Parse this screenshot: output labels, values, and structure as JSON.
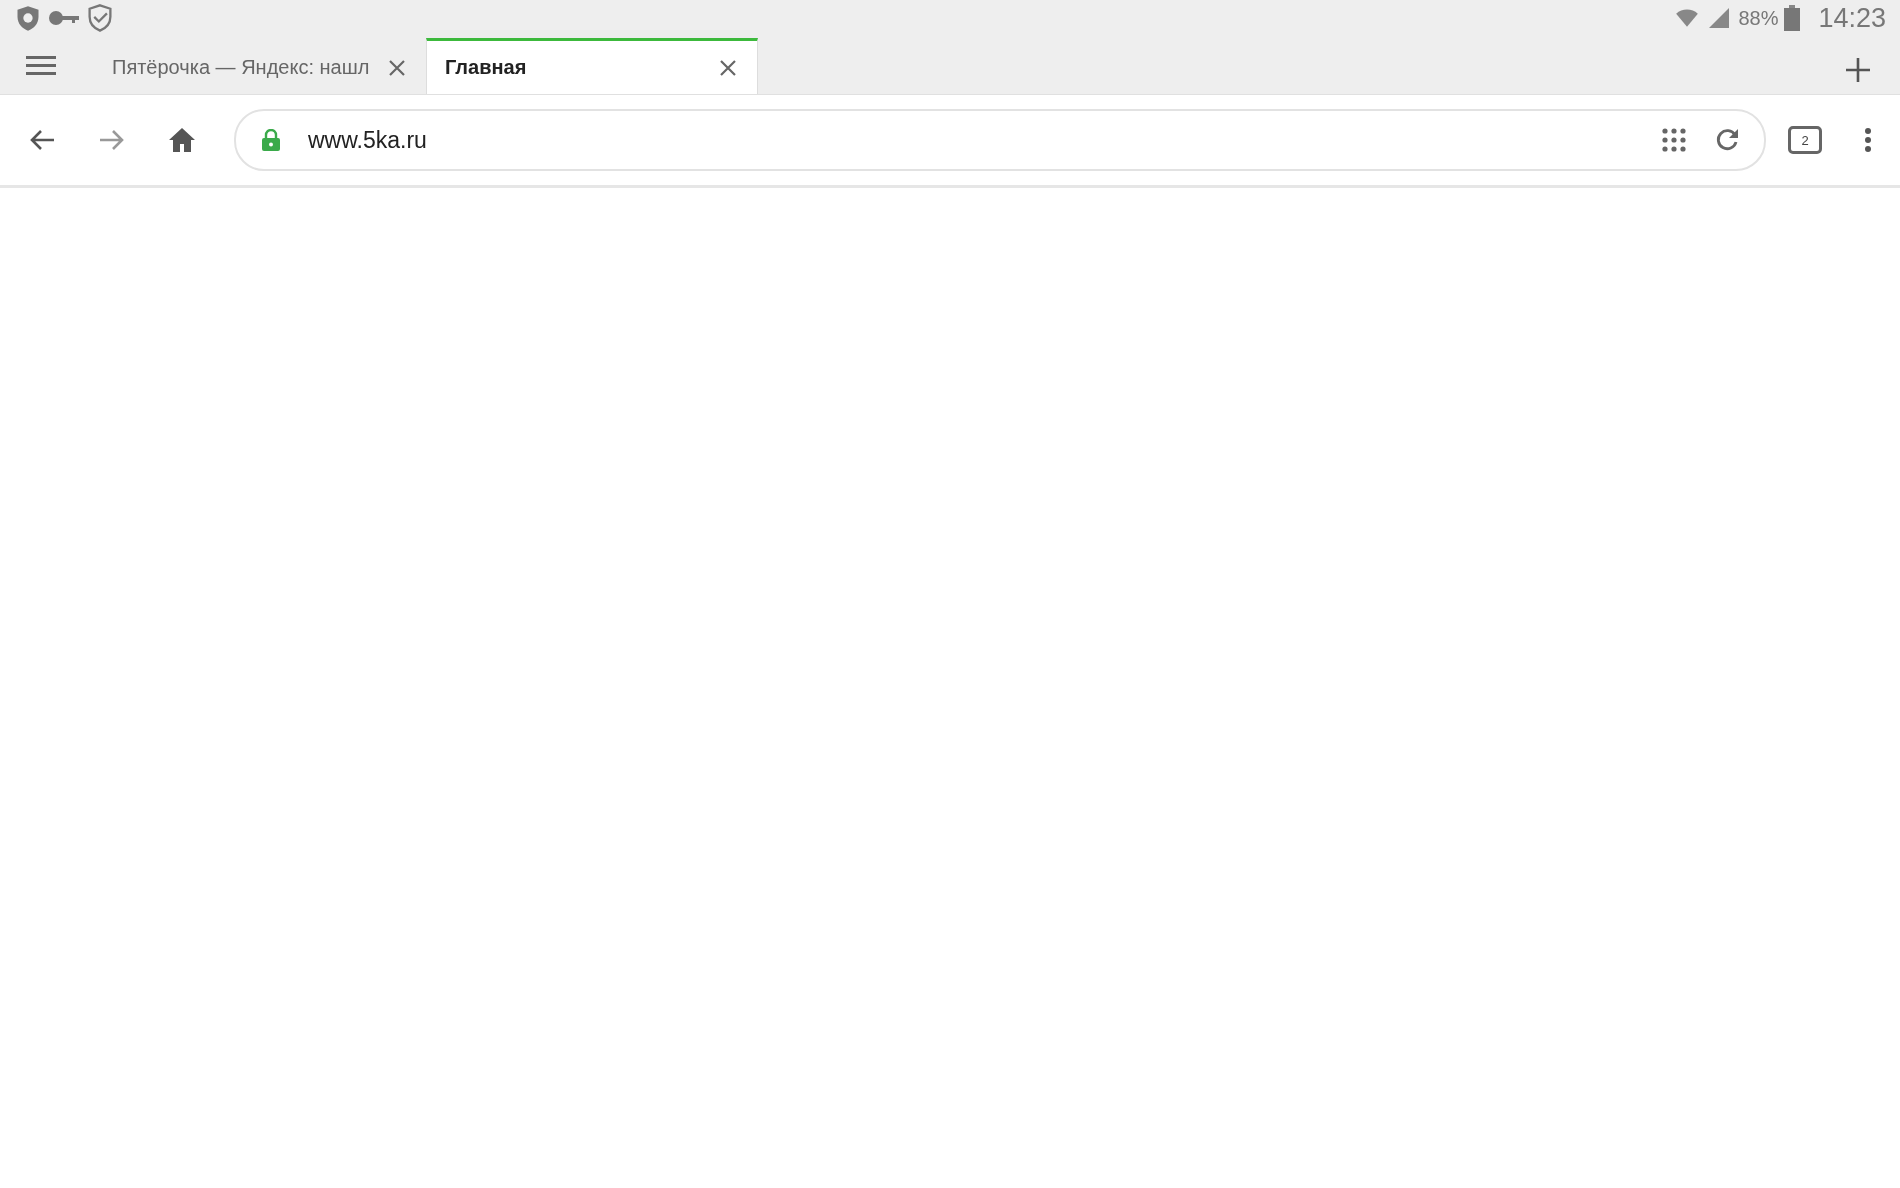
{
  "status_bar": {
    "battery": "88%",
    "time": "14:23"
  },
  "tabs": [
    {
      "title": "Пятёрочка — Яндекс: нашл",
      "selected": false
    },
    {
      "title": "Главная",
      "selected": true
    }
  ],
  "toolbar": {
    "url": "www.5ka.ru",
    "secure": true,
    "tab_count": "2"
  }
}
